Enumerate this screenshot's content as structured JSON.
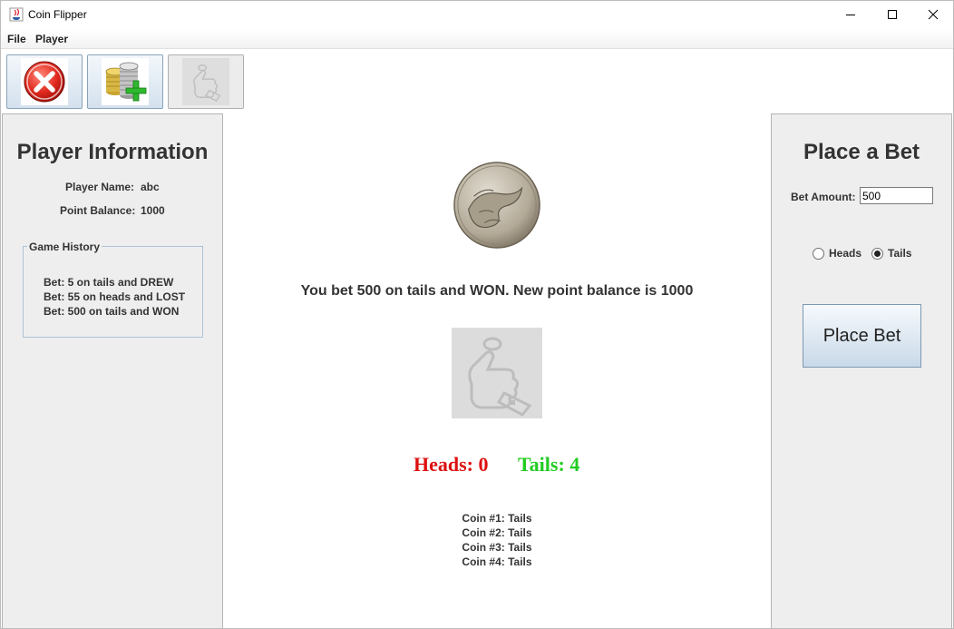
{
  "window": {
    "title": "Coin Flipper",
    "controls": [
      "minimize-icon",
      "maximize-icon",
      "close-icon"
    ]
  },
  "menu": {
    "file": "File",
    "player": "Player"
  },
  "toolbar": {
    "buttons": [
      {
        "icon": "exit-icon",
        "enabled": true
      },
      {
        "icon": "add-player-coins-icon",
        "enabled": true
      },
      {
        "icon": "coin-flip-thumb-icon",
        "enabled": false
      }
    ]
  },
  "player_info": {
    "heading": "Player Information",
    "name_label": "Player Name:",
    "name_value": "abc",
    "balance_label": "Point Balance:",
    "balance_value": "1000",
    "history_title": "Game History",
    "history": [
      "Bet: 5 on tails and DREW",
      "Bet: 55 on heads and LOST",
      "Bet: 500 on tails and WON"
    ]
  },
  "center": {
    "coin_icon": "coin-tails-icon",
    "result_message": "You bet 500 on tails and WON. New point balance is 1000",
    "flip_icon": "coin-flip-thumb-icon",
    "heads_tally": "Heads: 0",
    "tails_tally": "Tails: 4",
    "heads_color": "#dd1111",
    "tails_color": "#22cc22",
    "coins": [
      "Coin #1: Tails",
      "Coin #2: Tails",
      "Coin #3: Tails",
      "Coin #4: Tails"
    ]
  },
  "bet": {
    "heading": "Place a Bet",
    "amount_label": "Bet Amount:",
    "amount_value": "500",
    "option_heads": "Heads",
    "option_tails": "Tails",
    "selected": "Tails",
    "button_label": "Place Bet"
  }
}
